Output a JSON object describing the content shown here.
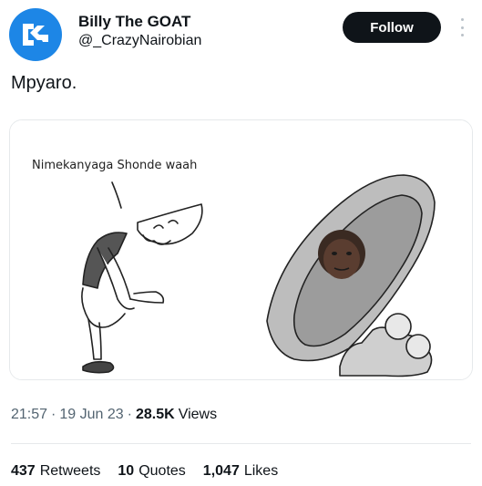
{
  "author": {
    "display_name": "Billy The GOAT",
    "handle": "@_CrazyNairobian",
    "avatar_icon": "nb-logo-icon",
    "avatar_color": "#1d86e6"
  },
  "follow_label": "Follow",
  "tweet_text": "Mpyaro.",
  "media": {
    "left_caption": "Nimekanyaga Shonde waah"
  },
  "meta": {
    "time": "21:57",
    "date": "19 Jun 23",
    "views_count": "28.5K",
    "views_label": "Views"
  },
  "stats": [
    {
      "num": "437",
      "label": "Retweets"
    },
    {
      "num": "10",
      "label": "Quotes"
    },
    {
      "num": "1,047",
      "label": "Likes"
    }
  ]
}
